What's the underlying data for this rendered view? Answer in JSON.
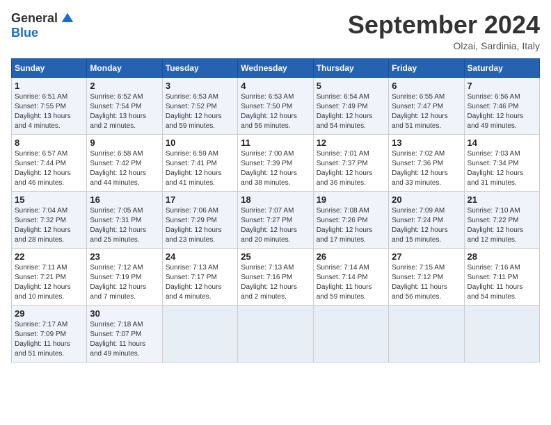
{
  "logo": {
    "general": "General",
    "blue": "Blue"
  },
  "title": "September 2024",
  "location": "Olzai, Sardinia, Italy",
  "headers": [
    "Sunday",
    "Monday",
    "Tuesday",
    "Wednesday",
    "Thursday",
    "Friday",
    "Saturday"
  ],
  "weeks": [
    [
      {
        "day": "1",
        "info": "Sunrise: 6:51 AM\nSunset: 7:55 PM\nDaylight: 13 hours\nand 4 minutes."
      },
      {
        "day": "2",
        "info": "Sunrise: 6:52 AM\nSunset: 7:54 PM\nDaylight: 13 hours\nand 2 minutes."
      },
      {
        "day": "3",
        "info": "Sunrise: 6:53 AM\nSunset: 7:52 PM\nDaylight: 12 hours\nand 59 minutes."
      },
      {
        "day": "4",
        "info": "Sunrise: 6:53 AM\nSunset: 7:50 PM\nDaylight: 12 hours\nand 56 minutes."
      },
      {
        "day": "5",
        "info": "Sunrise: 6:54 AM\nSunset: 7:49 PM\nDaylight: 12 hours\nand 54 minutes."
      },
      {
        "day": "6",
        "info": "Sunrise: 6:55 AM\nSunset: 7:47 PM\nDaylight: 12 hours\nand 51 minutes."
      },
      {
        "day": "7",
        "info": "Sunrise: 6:56 AM\nSunset: 7:46 PM\nDaylight: 12 hours\nand 49 minutes."
      }
    ],
    [
      {
        "day": "8",
        "info": "Sunrise: 6:57 AM\nSunset: 7:44 PM\nDaylight: 12 hours\nand 46 minutes."
      },
      {
        "day": "9",
        "info": "Sunrise: 6:58 AM\nSunset: 7:42 PM\nDaylight: 12 hours\nand 44 minutes."
      },
      {
        "day": "10",
        "info": "Sunrise: 6:59 AM\nSunset: 7:41 PM\nDaylight: 12 hours\nand 41 minutes."
      },
      {
        "day": "11",
        "info": "Sunrise: 7:00 AM\nSunset: 7:39 PM\nDaylight: 12 hours\nand 38 minutes."
      },
      {
        "day": "12",
        "info": "Sunrise: 7:01 AM\nSunset: 7:37 PM\nDaylight: 12 hours\nand 36 minutes."
      },
      {
        "day": "13",
        "info": "Sunrise: 7:02 AM\nSunset: 7:36 PM\nDaylight: 12 hours\nand 33 minutes."
      },
      {
        "day": "14",
        "info": "Sunrise: 7:03 AM\nSunset: 7:34 PM\nDaylight: 12 hours\nand 31 minutes."
      }
    ],
    [
      {
        "day": "15",
        "info": "Sunrise: 7:04 AM\nSunset: 7:32 PM\nDaylight: 12 hours\nand 28 minutes."
      },
      {
        "day": "16",
        "info": "Sunrise: 7:05 AM\nSunset: 7:31 PM\nDaylight: 12 hours\nand 25 minutes."
      },
      {
        "day": "17",
        "info": "Sunrise: 7:06 AM\nSunset: 7:29 PM\nDaylight: 12 hours\nand 23 minutes."
      },
      {
        "day": "18",
        "info": "Sunrise: 7:07 AM\nSunset: 7:27 PM\nDaylight: 12 hours\nand 20 minutes."
      },
      {
        "day": "19",
        "info": "Sunrise: 7:08 AM\nSunset: 7:26 PM\nDaylight: 12 hours\nand 17 minutes."
      },
      {
        "day": "20",
        "info": "Sunrise: 7:09 AM\nSunset: 7:24 PM\nDaylight: 12 hours\nand 15 minutes."
      },
      {
        "day": "21",
        "info": "Sunrise: 7:10 AM\nSunset: 7:22 PM\nDaylight: 12 hours\nand 12 minutes."
      }
    ],
    [
      {
        "day": "22",
        "info": "Sunrise: 7:11 AM\nSunset: 7:21 PM\nDaylight: 12 hours\nand 10 minutes."
      },
      {
        "day": "23",
        "info": "Sunrise: 7:12 AM\nSunset: 7:19 PM\nDaylight: 12 hours\nand 7 minutes."
      },
      {
        "day": "24",
        "info": "Sunrise: 7:13 AM\nSunset: 7:17 PM\nDaylight: 12 hours\nand 4 minutes."
      },
      {
        "day": "25",
        "info": "Sunrise: 7:13 AM\nSunset: 7:16 PM\nDaylight: 12 hours\nand 2 minutes."
      },
      {
        "day": "26",
        "info": "Sunrise: 7:14 AM\nSunset: 7:14 PM\nDaylight: 11 hours\nand 59 minutes."
      },
      {
        "day": "27",
        "info": "Sunrise: 7:15 AM\nSunset: 7:12 PM\nDaylight: 11 hours\nand 56 minutes."
      },
      {
        "day": "28",
        "info": "Sunrise: 7:16 AM\nSunset: 7:11 PM\nDaylight: 11 hours\nand 54 minutes."
      }
    ],
    [
      {
        "day": "29",
        "info": "Sunrise: 7:17 AM\nSunset: 7:09 PM\nDaylight: 11 hours\nand 51 minutes."
      },
      {
        "day": "30",
        "info": "Sunrise: 7:18 AM\nSunset: 7:07 PM\nDaylight: 11 hours\nand 49 minutes."
      },
      {
        "day": "",
        "info": ""
      },
      {
        "day": "",
        "info": ""
      },
      {
        "day": "",
        "info": ""
      },
      {
        "day": "",
        "info": ""
      },
      {
        "day": "",
        "info": ""
      }
    ]
  ]
}
